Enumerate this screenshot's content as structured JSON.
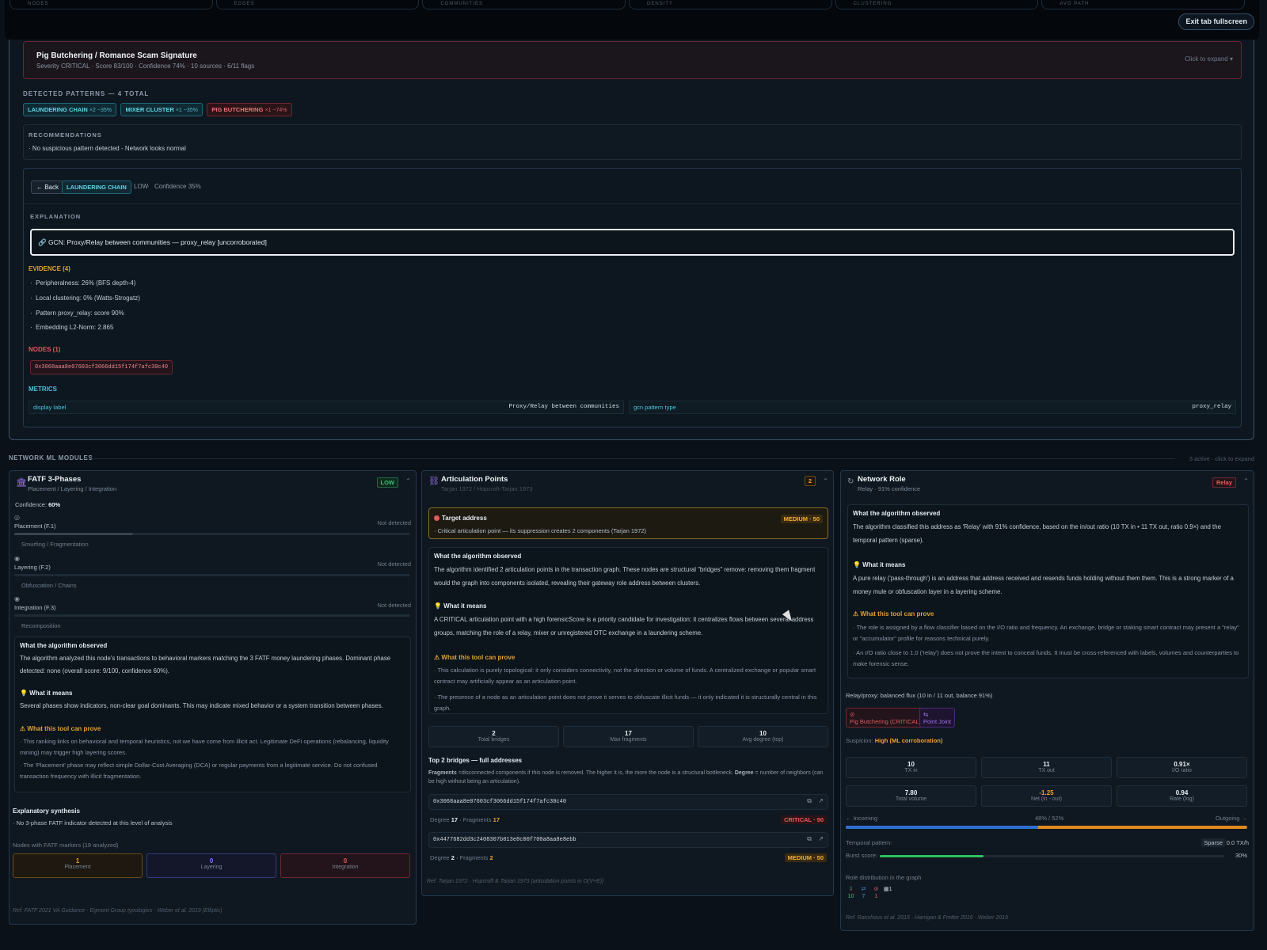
{
  "top": {
    "tabs": [
      "NODES",
      "EDGES",
      "COMMUNITIES",
      "DENSITY",
      "CLUSTERING",
      "AVG PATH"
    ],
    "exit_label": "Exit tab fullscreen"
  },
  "signature": {
    "title": "Pig Butchering / Romance Scam Signature",
    "subtitle": "Severity CRITICAL · Score 83/100 · Confidence 74% · 10 sources · 6/11 flags",
    "expand": "Click to expand ▾"
  },
  "patterns": {
    "label": "DETECTED PATTERNS — 4 TOTAL",
    "chips": [
      {
        "name": "LAUNDERING CHAIN",
        "extra": "×2 ~35%",
        "color": "#5fd3e6"
      },
      {
        "name": "MIXER CLUSTER",
        "extra": "×1 ~35%",
        "color": "#5fd3e6"
      },
      {
        "name": "PIG BUTCHERING",
        "extra": "×1 ~74%",
        "color": "#f07078"
      }
    ]
  },
  "recommendations": {
    "label": "RECOMMENDATIONS",
    "text": "· No suspicious pattern detected - Network looks normal"
  },
  "detail": {
    "back": "← Back",
    "tag": "LAUNDERING CHAIN",
    "level": "LOW",
    "sep": "·",
    "confidence": "Confidence 35%",
    "explanation_label": "EXPLANATION",
    "explanation": "🔗 GCN: Proxy/Relay between communities — proxy_relay [uncorroborated]",
    "evidence_label": "EVIDENCE (4)",
    "evidence": [
      "Peripheralness: 26% (BFS depth-4)",
      "Local clustering: 0% (Watts-Strogatz)",
      "Pattern proxy_relay: score 90%",
      "Embedding L2-Norm: 2.865"
    ],
    "nodes_label": "NODES (1)",
    "node": "0x3068aaa8e07603cf3066dd15f174f7afc30c40",
    "metrics_label": "METRICS",
    "metrics": [
      {
        "k": "display label",
        "v": "Proxy/Relay between communities"
      },
      {
        "k": "gcn pattern type",
        "v": "proxy_relay"
      }
    ]
  },
  "modules": {
    "label": "NETWORK ML MODULES",
    "count": "3 active · click to expand"
  },
  "fatf": {
    "title": "FATF 3-Phases",
    "subtitle": "Placement / Layering / Integration",
    "badge": "LOW",
    "confidence_label": "Confidence:",
    "confidence_value": "60%",
    "phases": [
      {
        "name": "Placement (F.1)",
        "status": "Not detected",
        "desc": "Smurfing / Fragmentation",
        "level": 0.3
      },
      {
        "name": "Layering (F.2)",
        "status": "Not detected",
        "desc": "Obfuscation / Chains",
        "level": 0
      },
      {
        "name": "Integration (F.3)",
        "status": "Not detected",
        "desc": "Recomposition",
        "level": 0
      }
    ],
    "observed_title": "What the algorithm observed",
    "observed_text": "The algorithm analyzed this node's transactions to behavioral markers matching the 3 FATF money laundering phases. Dominant phase detected: none (overall score: 9/100, confidence 60%).",
    "means_title": "💡 What it means",
    "means_text": "Several phases show indicators, non-clear goal dominants. This may indicate mixed behavior or a system transition between phases.",
    "prove_title": "⚠ What this tool can prove",
    "prove_items": [
      "This ranking links on behavioral and temporal heuristics, not we have come from illicit act. Legitimate DeFi operations (rebalancing, liquidity mining) may trigger high layering scores.",
      "The 'Placement' phase may reflect simple Dollar-Cost Averaging (DCA) or regular payments from a legitimate service. Do not confused transaction frequency with illicit fragmentation."
    ],
    "synth_title": "Explanatory synthesis",
    "synth_text": "· No 3-phase FATF indicator detected at this level of analysis",
    "nodes_label": "Nodes with FATF markers (19 analyzed)",
    "counts": [
      {
        "v": "1",
        "l": "Placement",
        "c": "#e0a030"
      },
      {
        "v": "0",
        "l": "Layering",
        "c": "#7b7cf0"
      },
      {
        "v": "0",
        "l": "Integration",
        "c": "#e05a5a"
      }
    ],
    "ref": "Ref. FATF 2021 VA Guidance · Egmont Group typologies · Weber et al. 2019 (Elliptic)"
  },
  "artic": {
    "title": "Articulation Points",
    "subtitle": "Tarjan 1972 / Hopcroft-Tarjan 1973",
    "count": "2",
    "target_title": "Target address",
    "target_badge": "MEDIUM · 50",
    "target_text": "· Critical articulation point — its suppression creates 2 components (Tarjan 1972)",
    "observed_title": "What the algorithm observed",
    "observed_text": "The algorithm identified 2 articulation points in the transaction graph. These nodes are structural \"bridges\" remove: removing them fragment would the graph into components isolated, revealing their gateway role address between clusters.",
    "means_title": "💡 What it means",
    "means_text": "A CRITICAL articulation point with a high forensicScore is a priority candidate for investigation: it centralizes flows between several address groups, matching the role of a relay, mixer or unregistered OTC exchange in a laundering scheme.",
    "prove_title": "⚠ What this tool can prove",
    "prove_items": [
      "This calculation is purely topological: it only considers connectivity, not the direction or volume of funds. A centralized exchange or popular smart contract may artificially appear as an articulation point.",
      "The presence of a node as an articulation point does not prove it serves to obfuscate illicit funds — it only indicated it is structurally central in this graph."
    ],
    "stats": [
      {
        "v": "2",
        "l": "Total bridges"
      },
      {
        "v": "17",
        "l": "Max fragments"
      },
      {
        "v": "10",
        "l": "Avg degree (top)"
      }
    ],
    "bridges_title": "Top 2 bridges — full addresses",
    "bridges_note_key": "Fragments",
    "bridges_note": " =disconnected components if this node is removed. The higher it is, the more the node is a structural bottleneck. ",
    "bridges_note_key2": "Degree",
    "bridges_note2": " = number of neighbors (can be high without being an articulation).",
    "bridges": [
      {
        "addr": "0x3068aaa8e07603cf3066dd15f174f7afc30c40",
        "degree": "17",
        "fragments": "17",
        "badge": "CRITICAL · 90"
      },
      {
        "addr": "0x4477682dd3c2408307b013e8c00f700a8aa8e8ebb",
        "degree": "2",
        "fragments": "2",
        "badge": "MEDIUM · 50"
      }
    ],
    "degree_label": "Degree",
    "fragments_label": "Fragments",
    "ref": "Ref. Tarjan 1972 · Hopcroft & Tarjan 1973 (articulation points in O(V+E))"
  },
  "role": {
    "title": "Network Role",
    "subtitle": "Relay · 91% confidence",
    "badge": "Relay",
    "observed_title": "What the algorithm observed",
    "observed_text": "The algorithm classified this address as 'Relay' with 91% confidence, based on the in/out ratio (10 TX in • 11 TX out, ratio 0.9×) and the temporal pattern (sparse).",
    "means_title": "💡 What it means",
    "means_text": "A pure relay ('pass-through') is an address that address received and resends funds holding without them them. This is a strong marker of a money mule or obfuscation layer in a layering scheme.",
    "prove_title": "⚠ What this tool can prove",
    "prove_items": [
      "The role is assigned by a flow classifier based on the I/O ratio and frequency. An exchange, bridge or staking smart contract may present a \"relay\" or \"accumulator\" profile for reasons technical purely.",
      "An I/O ratio close to 1.0 ('relay') does not prove the intent to conceal funds. It must be cross-referenced with labels, volumes and counterparties to make forensic sense."
    ],
    "flux": "Relay/proxy: balanced flux (10 in / 11 out, balance 91%)",
    "tags": [
      {
        "t": "Pig Butchering (CRITICAL)",
        "c": "#e05a5a"
      },
      {
        "t": "Point Joint",
        "c": "#a070f0"
      }
    ],
    "suspicion_label": "Suspicion:",
    "suspicion_value": "High (ML corroboration)",
    "stats": [
      {
        "v": "10",
        "l": "TX in",
        "c": "#e8eef4"
      },
      {
        "v": "11",
        "l": "TX out",
        "c": "#e8eef4"
      },
      {
        "v": "0.91×",
        "l": "I/O ratio",
        "c": "#e8eef4"
      },
      {
        "v": "7.80",
        "l": "Total volume",
        "c": "#e8eef4"
      },
      {
        "v": "-1.25",
        "l": "Net (in - out)",
        "c": "#f0a030"
      },
      {
        "v": "0.94",
        "l": "Rate (log)",
        "c": "#e8eef4"
      }
    ],
    "incoming": "← Incoming",
    "split": "48% / 52%",
    "incoming_share": 0.48,
    "outgoing": "Outgoing →",
    "temporal_label": "Temporal pattern:",
    "temporal_value": "Sparse",
    "temporal_rate": "0.0 TX/h",
    "burst_label": "Burst score:",
    "burst_value": "30%",
    "burst_level": 0.3,
    "dist_label": "Role distribution in the graph",
    "dist": [
      {
        "v": "10",
        "c": "#3ac07a"
      },
      {
        "v": "7",
        "c": "#4a8fe0"
      },
      {
        "v": "1",
        "c": "#e05a5a"
      },
      {
        "v": "1",
        "c": "#c8d0d8"
      }
    ],
    "ref": "Ref. Ranshous et al. 2015 · Harrigan & Fretter 2016 · Weber 2019"
  }
}
